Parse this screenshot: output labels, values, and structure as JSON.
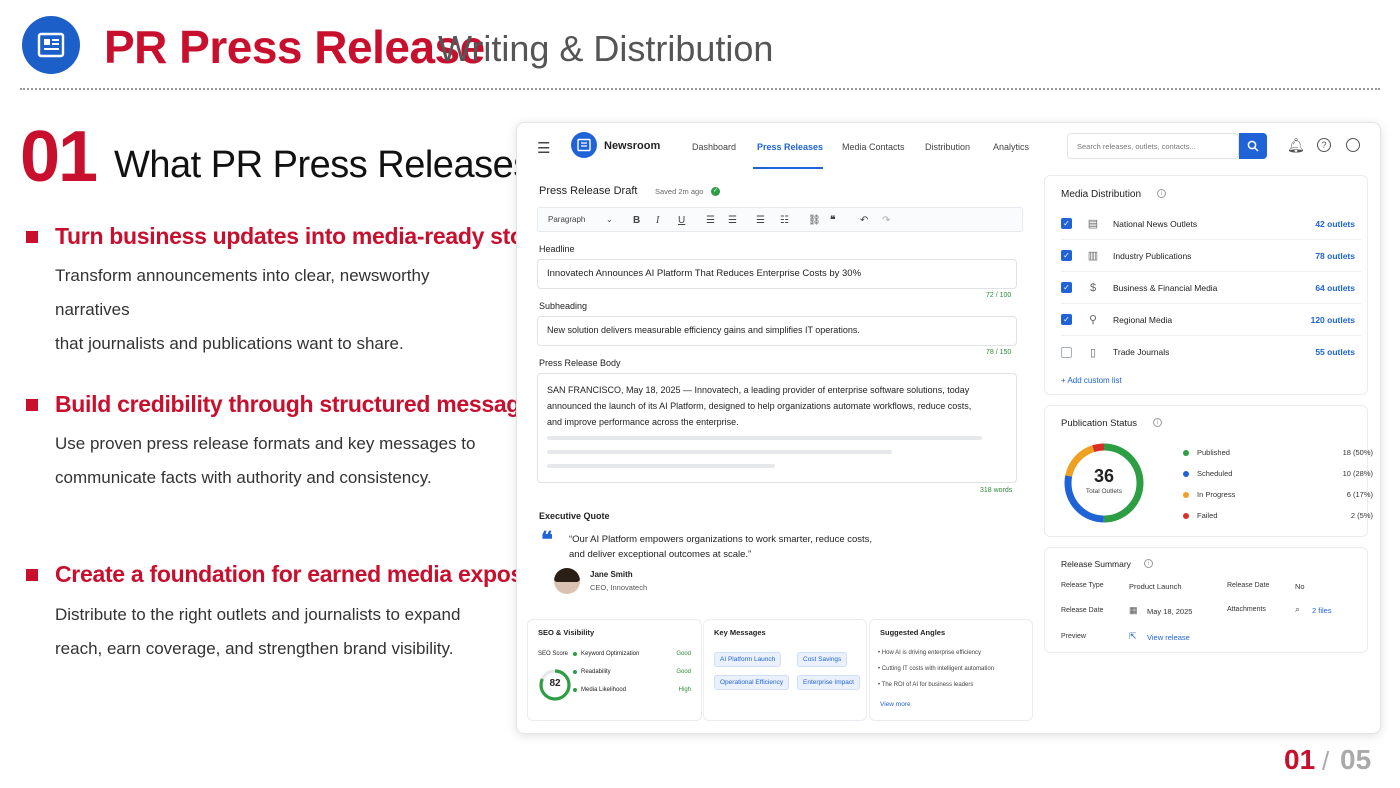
{
  "header": {
    "title": "PR Press Release",
    "subtitle": "Writing & Distribution"
  },
  "section": {
    "number": "01",
    "title": "What PR Press Releases Do"
  },
  "points": [
    {
      "heading": "Turn business updates into media-ready stories",
      "line1": "Transform announcements into clear, newsworthy narratives",
      "line2": "that journalists and publications want to share."
    },
    {
      "heading": "Build credibility through structured messaging",
      "line1": "Use proven press release formats and key messages to",
      "line2": "communicate facts with authority and consistency."
    },
    {
      "heading": "Create a foundation for earned media exposure",
      "line1": "Distribute to the right outlets and journalists to expand",
      "line2": "reach, earn coverage, and strengthen brand visibility."
    }
  ],
  "app": {
    "brand": "Newsroom",
    "nav": [
      "Dashboard",
      "Press Releases",
      "Media Contacts",
      "Distribution",
      "Analytics"
    ],
    "search_placeholder": "Search releases, outlets, contacts..."
  },
  "draft": {
    "title": "Press Release Draft",
    "saved": "Saved 2m ago",
    "toolbar_style": "Paragraph",
    "headline_label": "Headline",
    "headline": "Innovatech Announces AI Platform That Reduces Enterprise Costs by 30%",
    "headline_count": "72 / 100",
    "subheading_label": "Subheading",
    "subheading": "New solution delivers measurable efficiency gains and simplifies IT operations.",
    "subheading_count": "78 / 150",
    "body_label": "Press Release Body",
    "body": "SAN FRANCISCO, May 18, 2025 — Innovatech, a leading provider of enterprise software solutions, today announced the launch of its AI Platform, designed to help organizations automate workflows, reduce costs, and improve performance across the enterprise.",
    "word_count": "318 words",
    "quote_label": "Executive Quote",
    "quote_line1": "“Our AI Platform empowers organizations to work smarter, reduce costs,",
    "quote_line2": "and deliver exceptional outcomes at scale.”",
    "quote_name": "Jane Smith",
    "quote_role": "CEO, Innovatech"
  },
  "seo": {
    "title": "SEO & Visibility",
    "score_label": "SEO Score",
    "score": "82",
    "rows": [
      {
        "label": "Keyword Optimization",
        "value": "Good"
      },
      {
        "label": "Readability",
        "value": "Good"
      },
      {
        "label": "Media Likelihood",
        "value": "High"
      }
    ]
  },
  "key_messages": {
    "title": "Key Messages",
    "chips": [
      "AI Platform Launch",
      "Cost Savings",
      "Operational Efficiency",
      "Enterprise Impact"
    ]
  },
  "angles": {
    "title": "Suggested Angles",
    "items": [
      "How AI is driving enterprise efficiency",
      "Cutting IT costs with intelligent automation",
      "The ROI of AI for business leaders"
    ],
    "link": "View more"
  },
  "distribution": {
    "title": "Media Distribution",
    "rows": [
      {
        "name": "National News Outlets",
        "count": "42 outlets",
        "checked": true,
        "icon": "newspaper-icon"
      },
      {
        "name": "Industry Publications",
        "count": "78 outlets",
        "checked": true,
        "icon": "building-icon"
      },
      {
        "name": "Business & Financial Media",
        "count": "64 outlets",
        "checked": true,
        "icon": "dollar-icon"
      },
      {
        "name": "Regional Media",
        "count": "120 outlets",
        "checked": true,
        "icon": "location-pin-icon"
      },
      {
        "name": "Trade Journals",
        "count": "55 outlets",
        "checked": false,
        "icon": "book-icon"
      }
    ],
    "add_link": "+ Add custom list"
  },
  "publication": {
    "title": "Publication Status",
    "total": "36",
    "total_label": "Total Outlets",
    "rows": [
      {
        "label": "Published",
        "value": "18 (50%)",
        "color": "#2e9e44",
        "share": 0.5
      },
      {
        "label": "Scheduled",
        "value": "10 (28%)",
        "color": "#1f63d6",
        "share": 0.28
      },
      {
        "label": "In Progress",
        "value": "6 (17%)",
        "color": "#f0a020",
        "share": 0.17
      },
      {
        "label": "Failed",
        "value": "2 (5%)",
        "color": "#d93025",
        "share": 0.05
      }
    ]
  },
  "summary": {
    "title": "Release Summary",
    "type_label": "Release Type",
    "type": "Product Launch",
    "rdate_label": "Release Date",
    "rdate": "No",
    "date_label": "Release Date",
    "date": "May 18, 2025",
    "attach_label": "Attachments",
    "attach": "2 files",
    "preview_label": "Preview",
    "preview": "View release"
  },
  "pager": {
    "current": "01",
    "sep": "/",
    "total": "05"
  }
}
